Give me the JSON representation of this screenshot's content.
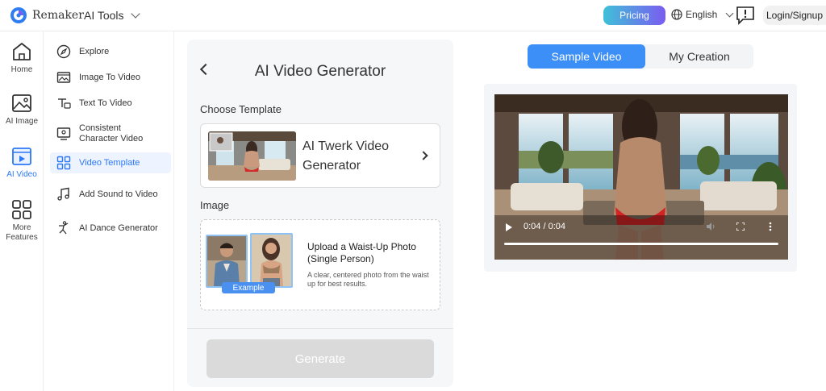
{
  "header": {
    "brand": "Remaker",
    "ai_tools": "AI Tools",
    "pricing": "Pricing",
    "language": "English",
    "login": "Login/Signup"
  },
  "rail": [
    {
      "label": "Home"
    },
    {
      "label": "AI Image"
    },
    {
      "label": "AI Video"
    },
    {
      "label": "More Features"
    }
  ],
  "submenu": [
    {
      "label": "Explore"
    },
    {
      "label": "Image To Video"
    },
    {
      "label": "Text To Video"
    },
    {
      "label": "Consistent Character Video"
    },
    {
      "label": "Video Template"
    },
    {
      "label": "Add Sound to Video"
    },
    {
      "label": "AI Dance Generator"
    }
  ],
  "panel": {
    "title": "AI Video Generator",
    "choose_template": "Choose Template",
    "template_name": "AI Twerk Video Generator",
    "image_label": "Image",
    "example_tag": "Example",
    "upload_title": "Upload a Waist-Up Photo (Single Person)",
    "upload_desc": "A clear, centered photo from the waist up for best results.",
    "generate": "Generate"
  },
  "tabs": {
    "sample": "Sample Video",
    "mine": "My Creation"
  },
  "video": {
    "time": "0:04 / 0:04"
  },
  "colors": {
    "accent": "#3b8ff6",
    "active_text": "#2c78f6"
  }
}
